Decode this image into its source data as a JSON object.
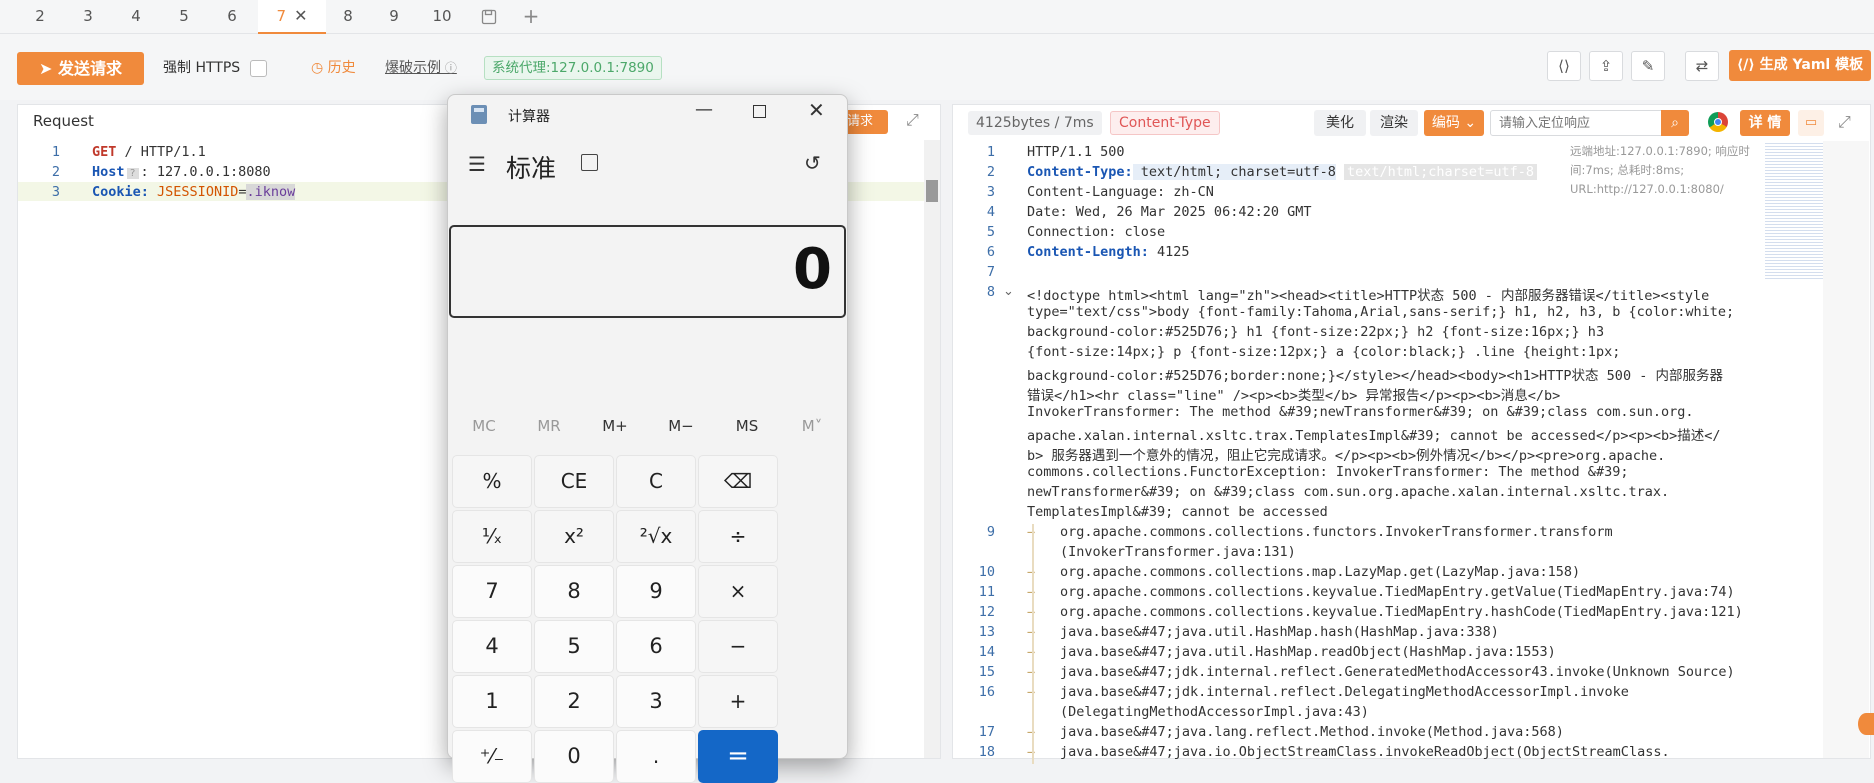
{
  "tabs": [
    {
      "label": "2"
    },
    {
      "label": "3"
    },
    {
      "label": "4"
    },
    {
      "label": "5"
    },
    {
      "label": "6"
    },
    {
      "label": "7",
      "active": true
    },
    {
      "label": "8"
    },
    {
      "label": "9"
    },
    {
      "label": "10"
    }
  ],
  "toolbar": {
    "send_label": "发送请求",
    "force_https_label": "强制 HTTPS",
    "history_label": "历史",
    "examples_label": "爆破示例",
    "proxy_label": "系统代理:127.0.0.1:7890",
    "yaml_label": "生成 Yaml 模板"
  },
  "request": {
    "title": "Request",
    "button_label": "请求",
    "lines": [
      {
        "num": "1",
        "method": "GET",
        "rest": " / HTTP/1.1"
      },
      {
        "num": "2",
        "key": "Host",
        "value": "127.0.0.1:8080"
      },
      {
        "num": "3",
        "key": "Cookie:",
        "cookie_name": "JSESSIONID",
        "cookie_value": ".iknow"
      }
    ]
  },
  "response": {
    "size_label": "4125bytes / 7ms",
    "content_type_label": "Content-Type",
    "beautify_label": "美化",
    "render_label": "渲染",
    "encode_label": "编码",
    "search_placeholder": "请输入定位响应",
    "detail_label": "详 情",
    "remote_info": "远端地址:127.0.0.1:7890; 响应时间:7ms; 总耗时:8ms; URL:http://127.0.0.1:8080/",
    "lines": [
      {
        "num": "1",
        "text": "HTTP/1.1 500"
      },
      {
        "num": "2",
        "key": "Content-Type:",
        "text": " text/html; charset=utf-8",
        "hint": "text/html;charset=utf-8"
      },
      {
        "num": "3",
        "text": "Content-Language: zh-CN"
      },
      {
        "num": "4",
        "text": "Date: Wed, 26 Mar 2025 06:42:20 GMT"
      },
      {
        "num": "5",
        "text": "Connection: close"
      },
      {
        "num": "6",
        "key": "Content-Length:",
        "text": " 4125"
      },
      {
        "num": "7",
        "text": ""
      }
    ],
    "body_lines": [
      "<!doctype html><html lang=\"zh\"><head><title>HTTP状态 500 - 内部服务器错误</title><style",
      "type=\"text/css\">body {font-family:Tahoma,Arial,sans-serif;} h1, h2, h3, b {color:white;",
      "background-color:#525D76;} h1 {font-size:22px;} h2 {font-size:16px;} h3",
      "{font-size:14px;} p {font-size:12px;} a {color:black;} .line {height:1px;",
      "background-color:#525D76;border:none;}</style></head><body><h1>HTTP状态 500 - 内部服务器",
      "错误</h1><hr class=\"line\" /><p><b>类型</b> 异常报告</p><p><b>消息</b>",
      "InvokerTransformer: The method &#39;newTransformer&#39; on &#39;class com.sun.org.",
      "apache.xalan.internal.xsltc.trax.TemplatesImpl&#39; cannot be accessed</p><p><b>描述</",
      "b> 服务器遇到一个意外的情况，阻止它完成请求。</p><p><b>例外情况</b></p><pre>org.apache.",
      "commons.collections.FunctorException: InvokerTransformer: The method &#39;",
      "newTransformer&#39; on &#39;class com.sun.org.apache.xalan.internal.xsltc.trax.",
      "TemplatesImpl&#39; cannot be accessed"
    ],
    "trace_lines": [
      {
        "num": "9",
        "text": "org.apache.commons.collections.functors.InvokerTransformer.transform",
        "cont": "(InvokerTransformer.java:131)"
      },
      {
        "num": "10",
        "text": "org.apache.commons.collections.map.LazyMap.get(LazyMap.java:158)"
      },
      {
        "num": "11",
        "text": "org.apache.commons.collections.keyvalue.TiedMapEntry.getValue(TiedMapEntry.java:74)"
      },
      {
        "num": "12",
        "text": "org.apache.commons.collections.keyvalue.TiedMapEntry.hashCode(TiedMapEntry.java:121)"
      },
      {
        "num": "13",
        "text": "java.base&#47;java.util.HashMap.hash(HashMap.java:338)"
      },
      {
        "num": "14",
        "text": "java.base&#47;java.util.HashMap.readObject(HashMap.java:1553)"
      },
      {
        "num": "15",
        "text": "java.base&#47;jdk.internal.reflect.GeneratedMethodAccessor43.invoke(Unknown Source)"
      },
      {
        "num": "16",
        "text": "java.base&#47;jdk.internal.reflect.DelegatingMethodAccessorImpl.invoke",
        "cont": "(DelegatingMethodAccessorImpl.java:43)"
      },
      {
        "num": "17",
        "text": "java.base&#47;java.lang.reflect.Method.invoke(Method.java:568)"
      },
      {
        "num": "18",
        "text": "java.base&#47;java.io.ObjectStreamClass.invokeReadObject(ObjectStreamClass."
      }
    ]
  },
  "calculator": {
    "window_title": "计算器",
    "mode": "标准",
    "display": "0",
    "memory": [
      "MC",
      "MR",
      "M+",
      "M−",
      "MS",
      "M˅"
    ],
    "keys": [
      [
        "%",
        "CE",
        "C",
        "⌫"
      ],
      [
        "¹⁄ₓ",
        "x²",
        "²√x",
        "÷"
      ],
      [
        "7",
        "8",
        "9",
        "×"
      ],
      [
        "4",
        "5",
        "6",
        "−"
      ],
      [
        "1",
        "2",
        "3",
        "+"
      ],
      [
        "⁺⁄₋",
        "0",
        ".",
        "="
      ]
    ]
  }
}
